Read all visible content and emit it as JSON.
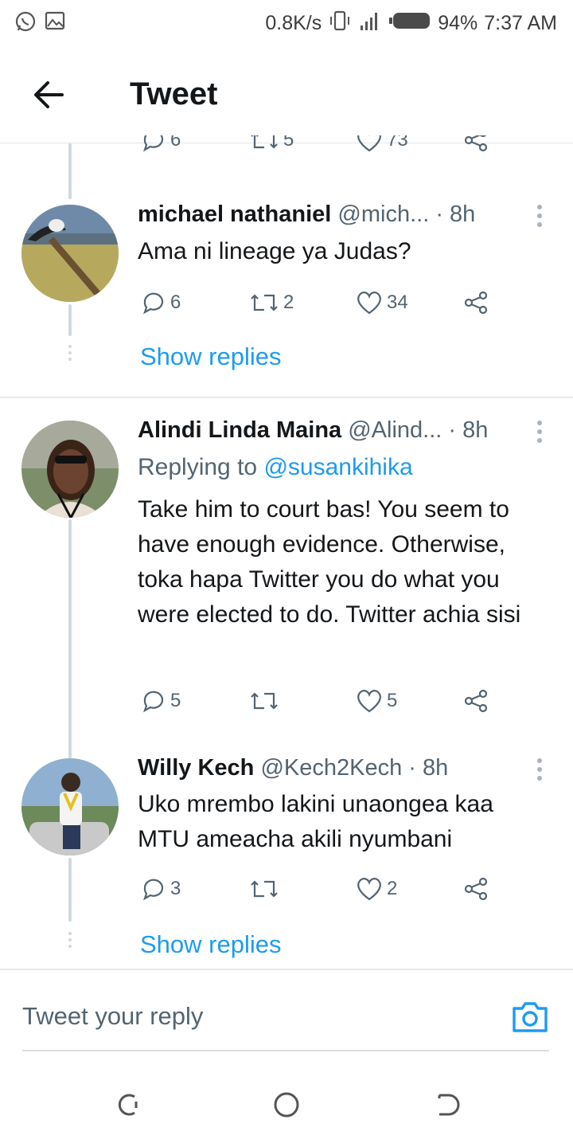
{
  "status_bar": {
    "speed": "0.8K/s",
    "battery": "94%",
    "time": "7:37 AM"
  },
  "header": {
    "title": "Tweet"
  },
  "prev_tweet_actions": {
    "replies": "6",
    "retweets": "5",
    "likes": "73"
  },
  "tweets": [
    {
      "name": "michael nathaniel",
      "handle": "@mich...",
      "time": "· 8h",
      "text": "Ama ni lineage ya Judas?",
      "replies": "6",
      "retweets": "2",
      "likes": "34",
      "show_replies": "Show replies"
    },
    {
      "name": "Alindi Linda Maina",
      "handle": "@Alind...",
      "time": "· 8h",
      "replying_prefix": "Replying to",
      "replying_to": "@susankihika",
      "text": "Take him to court bas! You seem to have enough evidence. Otherwise, toka hapa Twitter you do what you were elected to do. Twitter achia sisi",
      "replies": "5",
      "retweets": "",
      "likes": "5"
    },
    {
      "name": "Willy Kech",
      "handle": "@Kech2Kech",
      "time": "· 8h",
      "text": "Uko mrembo lakini unaongea kaa MTU ameacha akili nyumbani",
      "replies": "3",
      "retweets": "",
      "likes": "2",
      "show_replies": "Show replies"
    }
  ],
  "reply_bar": {
    "placeholder": "Tweet your reply"
  },
  "colors": {
    "accent": "#1d9bf0",
    "text": "#14171a",
    "secondary": "#536471"
  },
  "icons": [
    "whatsapp-icon",
    "gallery-icon",
    "vibrate-icon",
    "signal-icon",
    "battery-icon",
    "back-arrow-icon",
    "reply-icon",
    "retweet-icon",
    "like-icon",
    "share-icon",
    "more-icon",
    "camera-icon",
    "recents-icon",
    "home-icon",
    "back-nav-icon"
  ]
}
